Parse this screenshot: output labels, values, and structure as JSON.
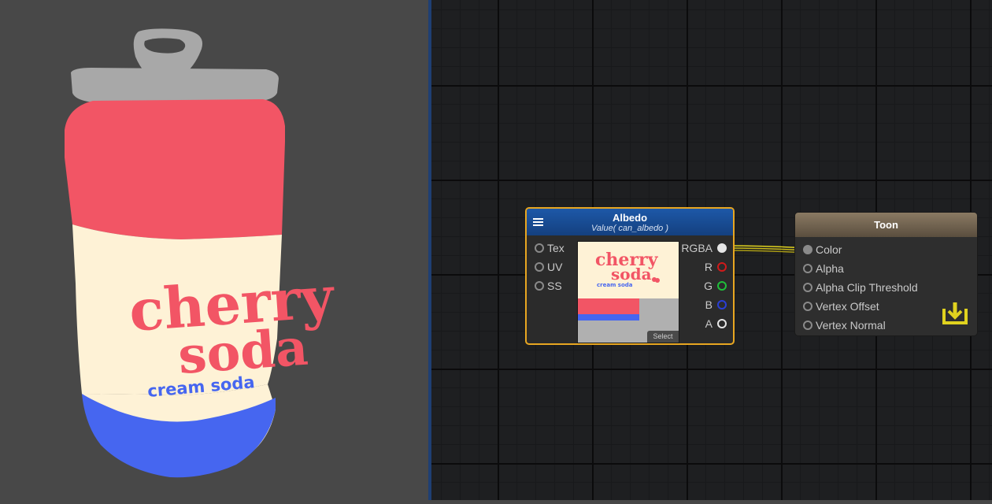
{
  "preview": {
    "can": {
      "label_main_line1": "cherry",
      "label_main_line2": "soda",
      "label_sub": "cream soda"
    }
  },
  "albedo_node": {
    "title": "Albedo",
    "subtitle": "Value( can_albedo )",
    "inputs": [
      "Tex",
      "UV",
      "SS"
    ],
    "outputs": [
      {
        "label": "RGBA",
        "color": "#e6e6e6"
      },
      {
        "label": "R",
        "color": "#d11a1a"
      },
      {
        "label": "G",
        "color": "#1fbf3a"
      },
      {
        "label": "B",
        "color": "#2a3fd6"
      },
      {
        "label": "A",
        "color": "#e6e6e6"
      }
    ],
    "texture_preview": {
      "line1": "cherry",
      "line2": "soda",
      "line3": "cream soda",
      "select_label": "Select"
    },
    "header_color": "#1d58a8",
    "border_color": "#e8a621"
  },
  "toon_node": {
    "title": "Toon",
    "inputs": [
      "Color",
      "Alpha",
      "Alpha Clip Threshold",
      "Vertex Offset",
      "Vertex Normal"
    ],
    "header_color": "#8a7a63",
    "master_icon": "download-icon",
    "master_icon_color": "#e0d21f"
  },
  "wire_color": "#e0d21f",
  "colors": {
    "can_red": "#f25565",
    "can_cream": "#fef2d6",
    "can_blue": "#4666f0",
    "can_lid": "#a8a8a8"
  }
}
